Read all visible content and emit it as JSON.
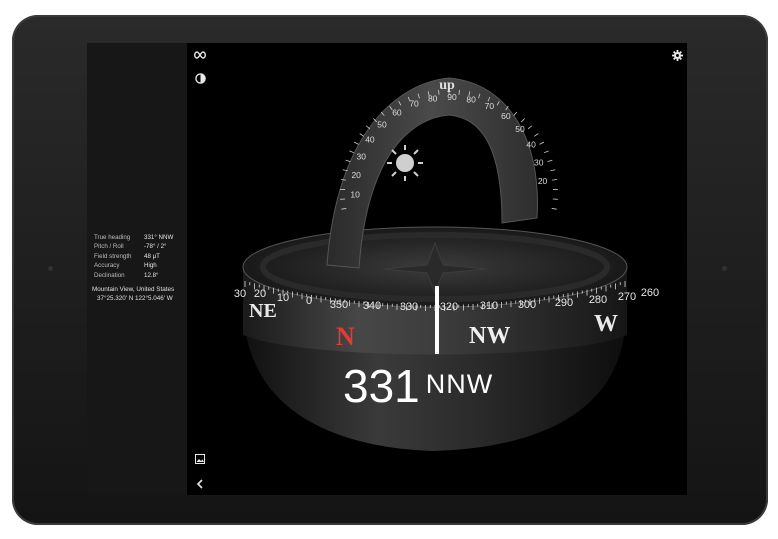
{
  "info": {
    "rows": [
      {
        "label": "True heading",
        "value": "331° NNW"
      },
      {
        "label": "Pitch / Roll",
        "value": "-78° / 2°"
      },
      {
        "label": "Field strength",
        "value": "48 μT"
      },
      {
        "label": "Accuracy",
        "value": "High"
      },
      {
        "label": "Declination",
        "value": "12.8°"
      }
    ],
    "location_name": "Mountain View, United States",
    "coordinates": "37°25.320' N 122°5.046' W"
  },
  "compass": {
    "heading_value": "331",
    "heading_direction": "NNW",
    "ring_labels": [
      "30",
      "20",
      "10",
      "0",
      "350",
      "340",
      "330",
      "320",
      "310",
      "300",
      "290",
      "280",
      "270",
      "260"
    ],
    "cardinal_labels": [
      "NE",
      "N",
      "NW",
      "W"
    ],
    "arc_labels": [
      "10",
      "20",
      "30",
      "40",
      "50",
      "60",
      "70",
      "80",
      "90",
      "80",
      "70",
      "60",
      "50",
      "40",
      "30",
      "20"
    ],
    "arc_top_label": "up",
    "north_color": "#e53935"
  },
  "icons": {
    "infinity": "infinity-icon",
    "theme": "brightness-icon",
    "settings": "gear-icon",
    "gallery": "image-icon",
    "collapse": "chevron-left-icon"
  }
}
